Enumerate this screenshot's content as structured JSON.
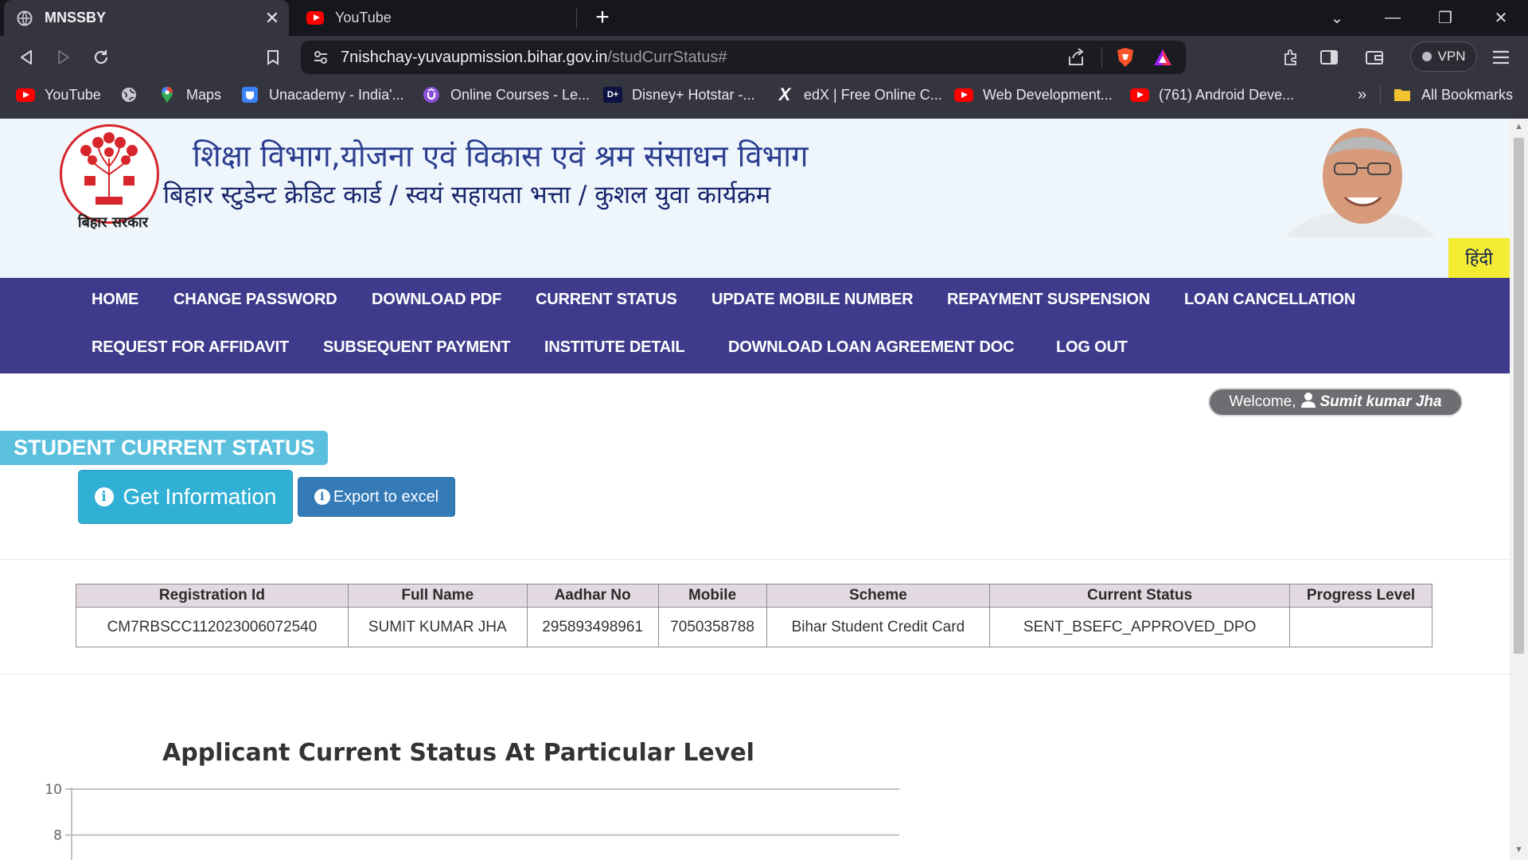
{
  "browser": {
    "tabs": [
      {
        "title": "MNSSBY",
        "active": true
      },
      {
        "title": "YouTube",
        "active": false
      }
    ],
    "url": {
      "host": "7nishchay-yuvaupmission.bihar.gov.in",
      "path": "/studCurrStatus#"
    },
    "vpn_label": "VPN",
    "bookmarks": [
      {
        "label": "YouTube",
        "icon": "youtube-icon"
      },
      {
        "label": "",
        "icon": "globe-icon"
      },
      {
        "label": "Maps",
        "icon": "maps-pin-icon"
      },
      {
        "label": "Unacademy - India'...",
        "icon": "unacademy-icon"
      },
      {
        "label": "Online Courses - Le...",
        "icon": "udemy-icon"
      },
      {
        "label": "Disney+ Hotstar -...",
        "icon": "hotstar-icon"
      },
      {
        "label": "edX | Free Online C...",
        "icon": "edx-icon"
      },
      {
        "label": "Web Development...",
        "icon": "youtube-icon"
      },
      {
        "label": "(761) Android Deve...",
        "icon": "youtube-icon"
      }
    ],
    "bookmarks_overflow": "»",
    "all_bookmarks_label": "All Bookmarks"
  },
  "header": {
    "title_hi": "शिक्षा विभाग,योजना एवं विकास एवं श्रम संसाधन विभाग",
    "subtitle_hi": "बिहार स्टुडेन्ट क्रेडिट कार्ड / स्वयं सहायता भत्ता / कुशल युवा कार्यक्रम",
    "emblem_label": "बिहार सरकार",
    "lang_button": "हिंदी"
  },
  "nav": {
    "row1": [
      "HOME",
      "CHANGE PASSWORD",
      "DOWNLOAD PDF",
      "CURRENT STATUS",
      "UPDATE MOBILE NUMBER",
      "REPAYMENT SUSPENSION",
      "LOAN CANCELLATION"
    ],
    "row2": [
      "REQUEST FOR AFFIDAVIT",
      "SUBSEQUENT PAYMENT",
      "INSTITUTE DETAIL",
      "DOWNLOAD LOAN AGREEMENT DOC",
      "LOG OUT"
    ]
  },
  "welcome": {
    "prefix": "Welcome,",
    "user": "Sumit kumar Jha"
  },
  "section_title": "STUDENT CURRENT STATUS",
  "buttons": {
    "get_info": "Get Information",
    "export": "Export to excel"
  },
  "table": {
    "headers": [
      "Registration Id",
      "Full Name",
      "Aadhar No",
      "Mobile",
      "Scheme",
      "Current Status",
      "Progress Level"
    ],
    "rows": [
      [
        "CM7RBSCC112023006072540",
        "SUMIT KUMAR JHA",
        "295893498961",
        "7050358788",
        "Bihar Student Credit Card",
        "SENT_BSEFC_APPROVED_DPO",
        ""
      ]
    ]
  },
  "chart_data": {
    "type": "bar",
    "title": "Applicant Current Status At Particular Level",
    "xlabel": "",
    "ylabel": "",
    "visible_ticks": [
      10,
      8
    ],
    "ylim": [
      0,
      10
    ],
    "grid": true
  },
  "colors": {
    "nav_bg": "#3f3b8c",
    "header_bg": "#eef6fc",
    "section_title_bg": "#5bc0de",
    "info_button": "#31b0d5",
    "export_button": "#337ab7",
    "table_header_bg": "#e3d9e0",
    "lang_button_bg": "#f4ec32"
  }
}
